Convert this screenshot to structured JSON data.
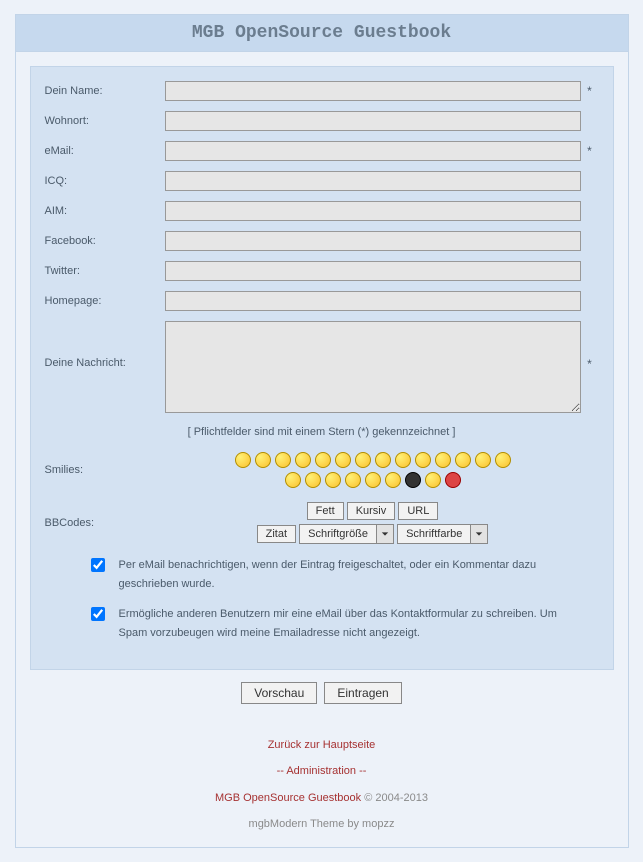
{
  "header": {
    "title": "MGB OpenSource Guestbook"
  },
  "fields": {
    "name": {
      "label": "Dein Name:",
      "required": "*"
    },
    "wohnort": {
      "label": "Wohnort:",
      "required": ""
    },
    "email": {
      "label": "eMail:",
      "required": "*"
    },
    "icq": {
      "label": "ICQ:",
      "required": ""
    },
    "aim": {
      "label": "AIM:",
      "required": ""
    },
    "facebook": {
      "label": "Facebook:",
      "required": ""
    },
    "twitter": {
      "label": "Twitter:",
      "required": ""
    },
    "homepage": {
      "label": "Homepage:",
      "required": ""
    },
    "message": {
      "label": "Deine Nachricht:",
      "required": "*"
    }
  },
  "note": "[ Pflichtfelder sind mit einem Stern (*) gekennzeichnet ]",
  "smilies": {
    "label": "Smilies:"
  },
  "bbcodes": {
    "label": "BBCodes:",
    "fett": "Fett",
    "kursiv": "Kursiv",
    "url": "URL",
    "zitat": "Zitat",
    "size": "Schriftgröße",
    "color": "Schriftfarbe"
  },
  "checks": {
    "notify": "Per eMail benachrichtigen, wenn der Eintrag freigeschaltet, oder ein Kommentar dazu geschrieben wurde.",
    "contact": "Ermögliche anderen Benutzern mir eine eMail über das Kontaktformular zu schreiben. Um Spam vorzubeugen wird meine Emailadresse nicht angezeigt."
  },
  "buttons": {
    "preview": "Vorschau",
    "submit": "Eintragen"
  },
  "footer": {
    "back": "Zurück zur Hauptseite",
    "admin": "Administration",
    "sep": "--",
    "brand": "MGB OpenSource Guestbook",
    "copy": " © 2004-2013",
    "theme": "mgbModern Theme by mopzz"
  }
}
